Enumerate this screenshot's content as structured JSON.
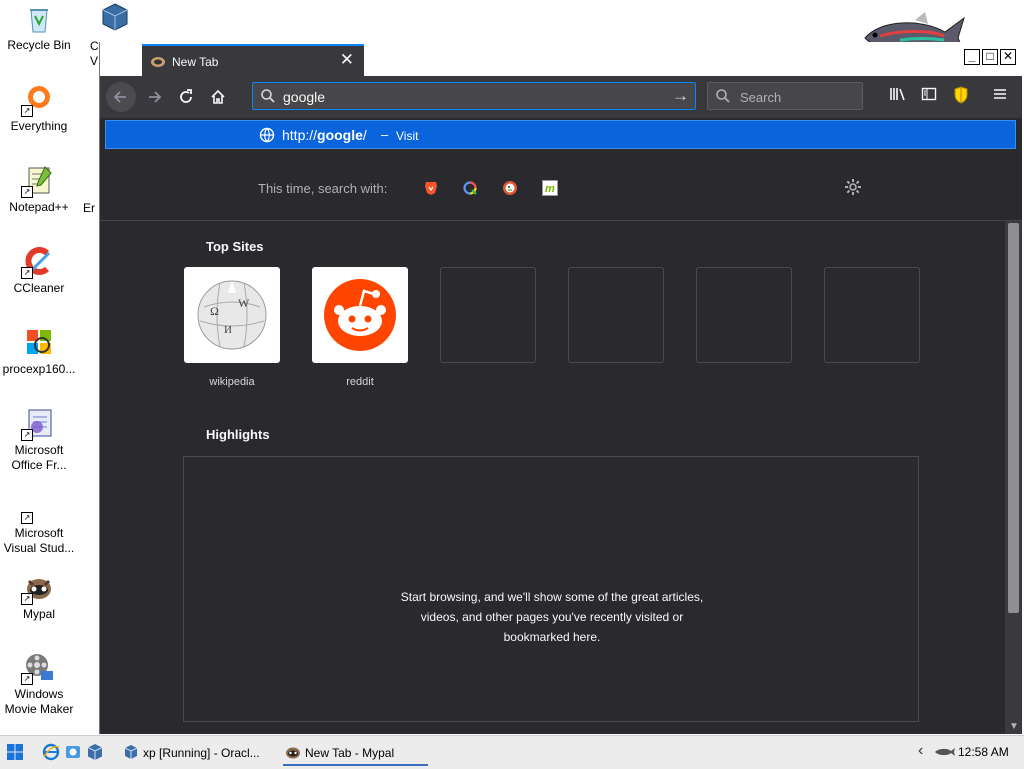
{
  "desktop": {
    "icons": [
      {
        "label": "Recycle Bin",
        "icon": "recycle-bin-icon"
      },
      {
        "label": "Everything",
        "icon": "everything-icon"
      },
      {
        "label": "Notepad++",
        "icon": "notepad-plus-plus-icon"
      },
      {
        "label": "CCleaner",
        "icon": "ccleaner-icon"
      },
      {
        "label": "procexp160...",
        "icon": "process-explorer-icon"
      },
      {
        "label": "Microsoft Office Fr...",
        "icon": "office-frontpage-icon"
      },
      {
        "label": "Microsoft Visual Stud...",
        "icon": "visual-studio-icon"
      },
      {
        "label": "Mypal",
        "icon": "mypal-icon"
      },
      {
        "label": "Windows Movie Maker",
        "icon": "movie-maker-icon"
      }
    ],
    "partial_labels": [
      "C",
      "V",
      "Er"
    ]
  },
  "browser": {
    "tab_title": "New Tab",
    "tab_close": "✕",
    "window_controls": {
      "minimize": "_",
      "maximize": "□",
      "close": "✕"
    },
    "url_value": "google",
    "search_placeholder": "Search",
    "suggestion": {
      "url_prefix": "http://",
      "url_bold": "google",
      "url_suffix": "/",
      "separator": "–",
      "action": "Visit"
    },
    "one_off_label": "This time, search with:",
    "engines": [
      "brave-icon",
      "qwant-icon",
      "duckduckgo-icon",
      "mojeek-icon"
    ],
    "top_sites_title": "Top Sites",
    "top_sites": [
      {
        "label": "wikipedia",
        "icon": "wikipedia-icon"
      },
      {
        "label": "reddit",
        "icon": "reddit-icon"
      },
      {
        "label": ""
      },
      {
        "label": ""
      },
      {
        "label": ""
      },
      {
        "label": ""
      }
    ],
    "highlights_title": "Highlights",
    "highlights_message": [
      "Start browsing, and we'll show some of the great articles,",
      "videos, and other pages you've recently visited or",
      "bookmarked here."
    ]
  },
  "taskbar": {
    "tasks": [
      {
        "label": "xp [Running] - Oracl...",
        "icon": "virtualbox-icon"
      },
      {
        "label": "New Tab - Mypal",
        "icon": "mypal-icon"
      }
    ],
    "clock": "12:58 AM"
  },
  "colors": {
    "accent": "#0a84ff",
    "suggestion_bg": "#0a64dc",
    "toolbar": "#38383d",
    "content_bg": "#2a2a2e",
    "reddit": "#ff4500"
  }
}
